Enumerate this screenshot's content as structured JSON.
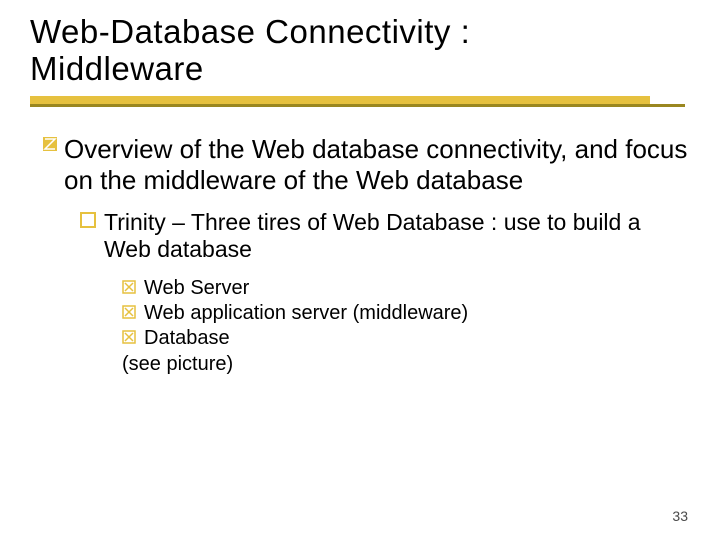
{
  "title_line1": "Web-Database Connectivity :",
  "title_line2": "Middleware",
  "bullets": {
    "l1": "Overview of the Web database connectivity, and focus on the middleware of the Web database",
    "l2": "Trinity – Three tires of Web Database : use to build a Web database",
    "l3": [
      "Web Server",
      "Web application server (middleware)",
      "Database"
    ],
    "l3_plain": "(see picture)"
  },
  "page": "33"
}
